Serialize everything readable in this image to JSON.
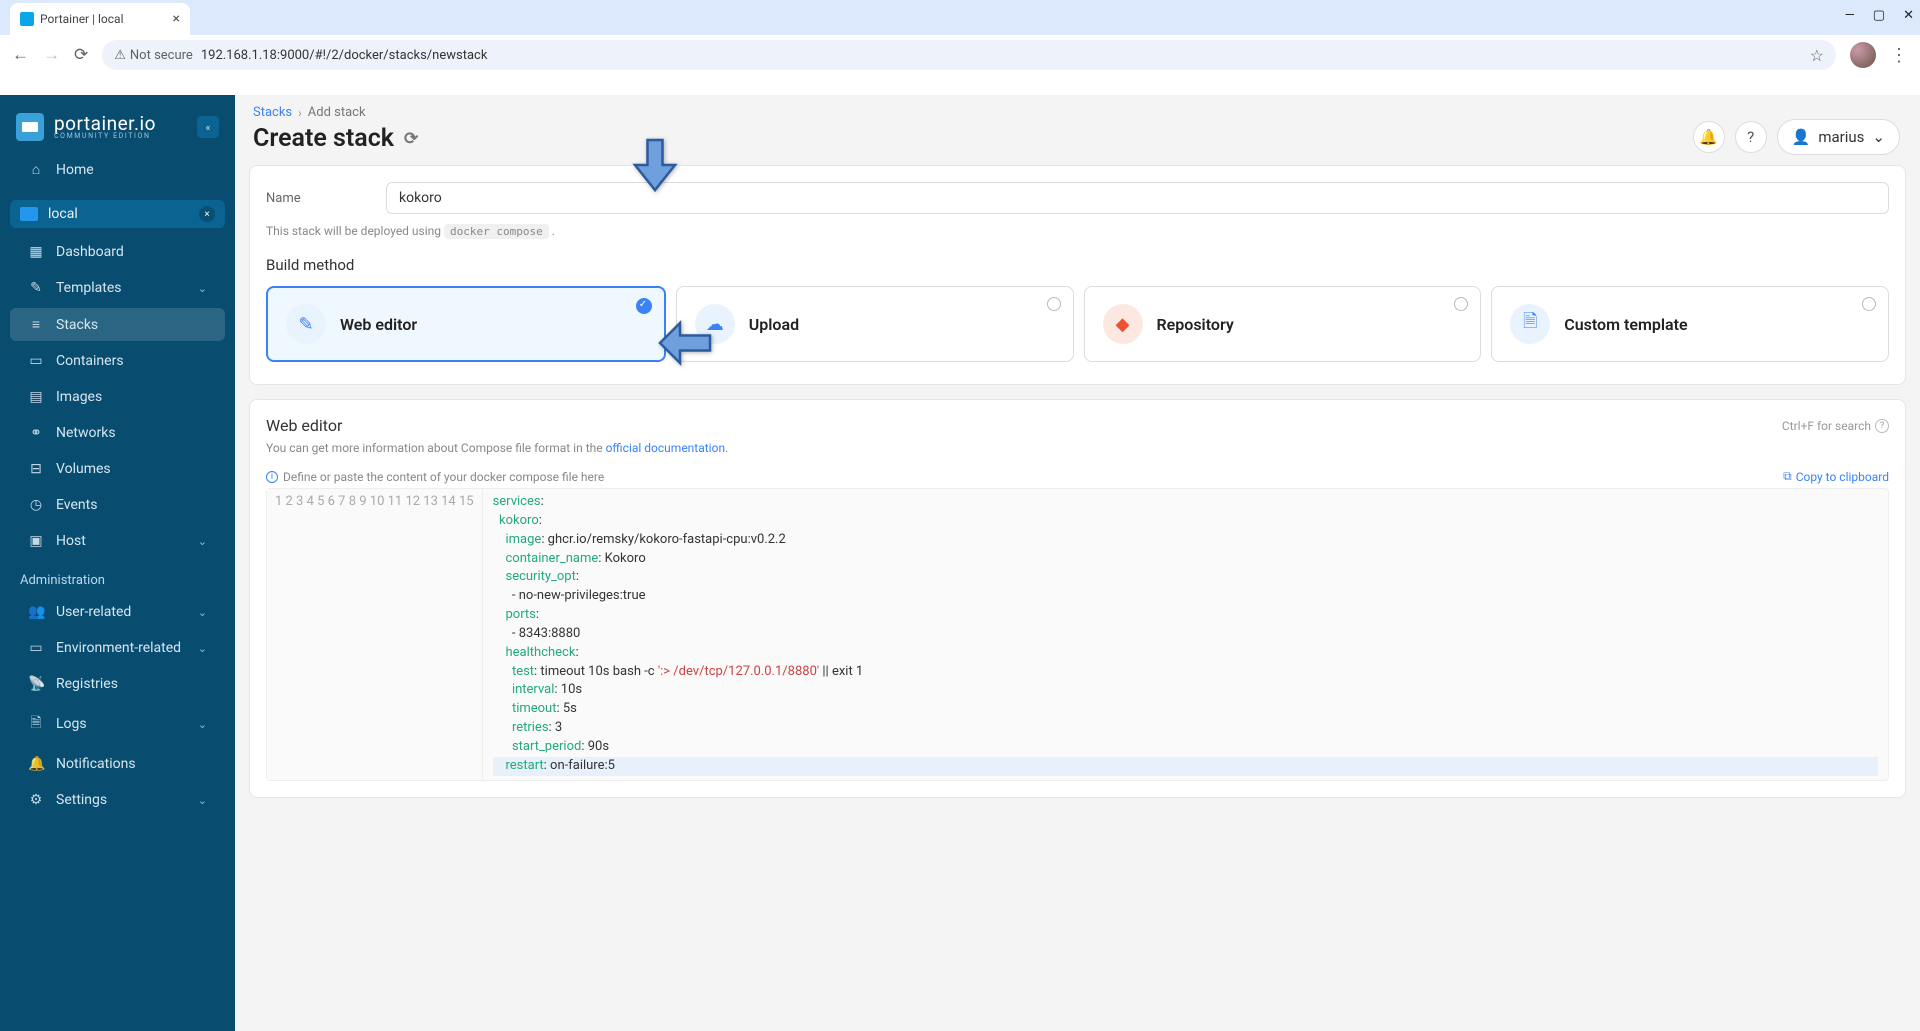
{
  "browser": {
    "tabTitle": "Portainer | local",
    "url": "192.168.1.18:9000/#!/2/docker/stacks/newstack",
    "notSecure": "Not secure",
    "winMin": "—",
    "winMax": "▢",
    "winClose": "✕"
  },
  "logo": {
    "name": "portainer.io",
    "edition": "COMMUNITY EDITION"
  },
  "nav": {
    "home": "Home",
    "local": "local",
    "dashboard": "Dashboard",
    "templates": "Templates",
    "stacks": "Stacks",
    "containers": "Containers",
    "images": "Images",
    "networks": "Networks",
    "volumes": "Volumes",
    "events": "Events",
    "host": "Host",
    "admin": "Administration",
    "user": "User-related",
    "env": "Environment-related",
    "reg": "Registries",
    "logs": "Logs",
    "notif": "Notifications",
    "settings": "Settings"
  },
  "crumbs": {
    "stacks": "Stacks",
    "add": "Add stack"
  },
  "title": "Create stack",
  "user": "marius",
  "form": {
    "nameLabel": "Name",
    "nameValue": "kokoro",
    "deployNote": "This stack will be deployed using ",
    "deployCode": "docker compose",
    "buildMethod": "Build method"
  },
  "methods": {
    "web": "Web editor",
    "upload": "Upload",
    "repo": "Repository",
    "tmpl": "Custom template"
  },
  "editor": {
    "title": "Web editor",
    "searchHint": "Ctrl+F for search",
    "desc": "You can get more information about Compose file format in the ",
    "docLink": "official documentation",
    "define": "Define or paste the content of your docker compose file here",
    "copy": "Copy to clipboard"
  },
  "codeLines": [
    "services:",
    "  kokoro:",
    "    image: ghcr.io/remsky/kokoro-fastapi-cpu:v0.2.2",
    "    container_name: Kokoro",
    "    security_opt:",
    "      - no-new-privileges:true",
    "    ports:",
    "      - 8343:8880",
    "    healthcheck:",
    "      test: timeout 10s bash -c ':> /dev/tcp/127.0.0.1/8880' || exit 1",
    "      interval: 10s",
    "      timeout: 5s",
    "      retries: 3",
    "      start_period: 90s",
    "    restart: on-failure:5"
  ]
}
